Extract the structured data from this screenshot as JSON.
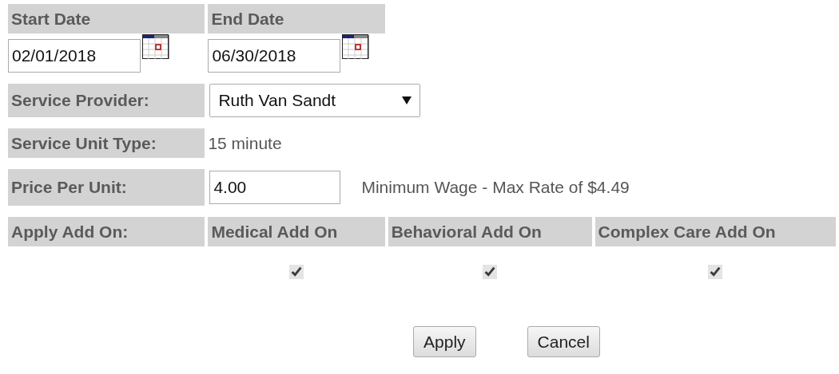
{
  "date_range": [
    {
      "label": "Start Date",
      "value": "02/01/2018"
    },
    {
      "label": "End Date",
      "value": "06/30/2018"
    }
  ],
  "service_provider": {
    "label": "Service Provider:",
    "value": "Ruth Van Sandt"
  },
  "service_unit_type": {
    "label": "Service Unit Type:",
    "value": "15 minute"
  },
  "price_per_unit": {
    "label": "Price Per Unit:",
    "value": "4.00",
    "note": "Minimum Wage - Max Rate of $4.49"
  },
  "add_ons": {
    "label": "Apply Add On:",
    "options": [
      {
        "label": "Medical Add On",
        "checked": true
      },
      {
        "label": "Behavioral Add On",
        "checked": true
      },
      {
        "label": "Complex Care Add On",
        "checked": true
      }
    ]
  },
  "buttons": [
    "Apply",
    "Cancel"
  ]
}
